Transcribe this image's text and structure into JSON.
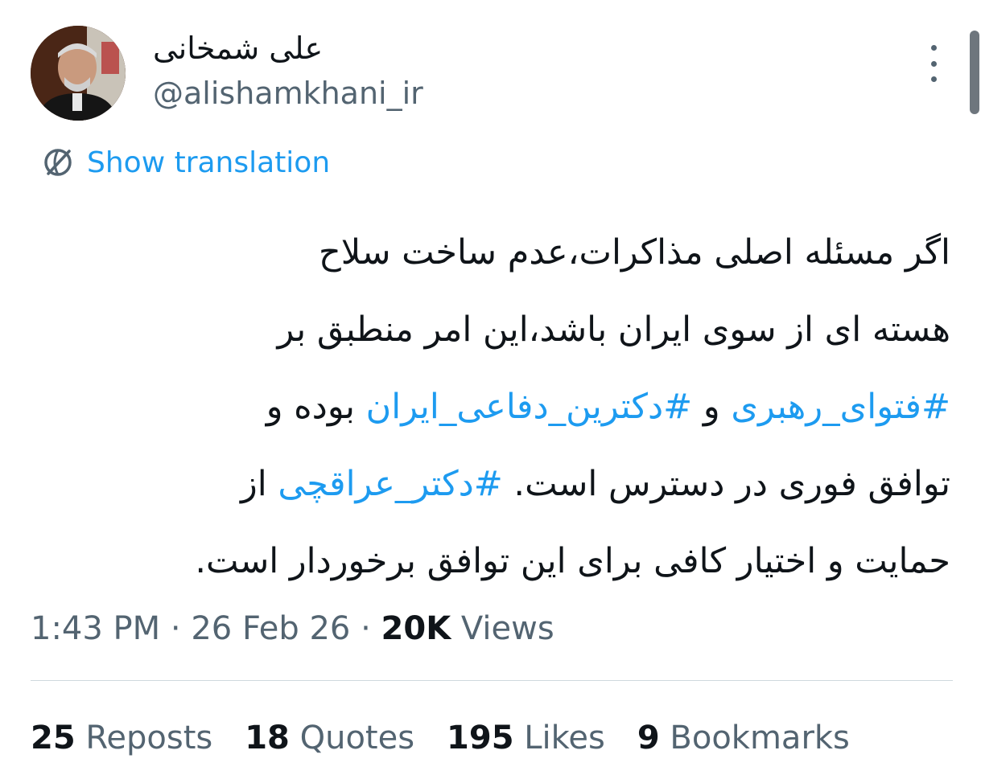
{
  "author": {
    "display_name": "علی شمخانی",
    "handle": "@alishamkhani_ir"
  },
  "translate": {
    "label": "Show translation",
    "icon": "globe-icon"
  },
  "tweet": {
    "segments": [
      [
        {
          "text": "اگر مسئله اصلی مذاکرات،عدم ساخت سلاح",
          "type": "text"
        }
      ],
      [
        {
          "text": "هسته ای از سوی ایران باشد،این امر منطبق بر",
          "type": "text"
        }
      ],
      [
        {
          "text": "#فتوای_رهبری",
          "type": "hashtag"
        },
        {
          "text": " و ",
          "type": "text"
        },
        {
          "text": "#دکترین_دفاعی_ایران",
          "type": "hashtag"
        },
        {
          "text": " بوده و",
          "type": "text"
        }
      ],
      [
        {
          "text": "توافق فوری در دسترس است. ",
          "type": "text"
        },
        {
          "text": "#دکتر_عراقچی",
          "type": "hashtag"
        },
        {
          "text": " از",
          "type": "text"
        }
      ],
      [
        {
          "text": "حمایت و اختیار کافی برای این توافق برخوردار است.",
          "type": "text"
        }
      ]
    ]
  },
  "meta": {
    "time": "1:43 PM",
    "sep1": " · ",
    "date": "26 Feb 26",
    "sep2": " · ",
    "views_count": "20K",
    "views_label": " Views"
  },
  "stats": {
    "reposts_count": "25",
    "reposts_label": " Reposts",
    "quotes_count": "18",
    "quotes_label": " Quotes",
    "likes_count": "195",
    "likes_label": " Likes",
    "bookmarks_count": "9",
    "bookmarks_label": " Bookmarks"
  },
  "colors": {
    "accent": "#1d9bf0",
    "text_primary": "#0f1419",
    "text_secondary": "#536471",
    "divider": "#cfd9de"
  }
}
